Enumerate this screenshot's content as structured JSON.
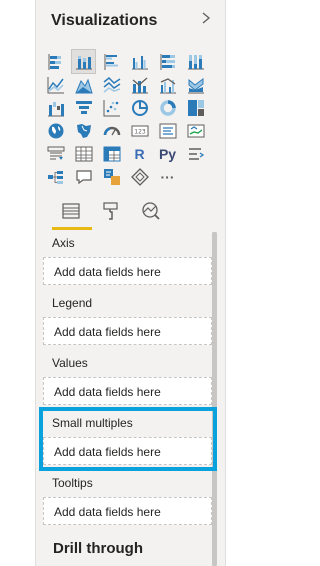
{
  "pane": {
    "title": "Visualizations"
  },
  "visual_types": [
    "stacked-bar-chart-icon",
    "stacked-column-chart-icon",
    "clustered-bar-chart-icon",
    "clustered-column-chart-icon",
    "100-stacked-bar-chart-icon",
    "100-stacked-column-chart-icon",
    "line-chart-icon",
    "area-chart-icon",
    "stacked-area-chart-icon",
    "line-and-stacked-column-icon",
    "line-and-clustered-column-icon",
    "ribbon-chart-icon",
    "waterfall-chart-icon",
    "funnel-chart-icon",
    "scatter-chart-icon",
    "pie-chart-icon",
    "donut-chart-icon",
    "treemap-icon",
    "map-icon",
    "filled-map-icon",
    "gauge-icon",
    "card-icon",
    "multi-row-card-icon",
    "kpi-icon",
    "slicer-icon",
    "table-icon",
    "matrix-icon",
    "r-script-visual-icon",
    "python-visual-icon",
    "key-influencers-icon",
    "decomposition-tree-icon",
    "qa-icon",
    "smart-narrative-icon",
    "power-apps-icon",
    "more-visuals-icon"
  ],
  "tabs": [
    "fields-tab-icon",
    "format-tab-icon",
    "analytics-tab-icon"
  ],
  "wells": [
    {
      "label": "Axis",
      "placeholder": "Add data fields here"
    },
    {
      "label": "Legend",
      "placeholder": "Add data fields here"
    },
    {
      "label": "Values",
      "placeholder": "Add data fields here"
    },
    {
      "label": "Small multiples",
      "placeholder": "Add data fields here"
    },
    {
      "label": "Tooltips",
      "placeholder": "Add data fields here"
    }
  ],
  "drill_through": "Drill through",
  "visual_glyphs": {
    "r": "R",
    "py": "Py",
    "more": "···"
  },
  "accent_color": "#e8b913",
  "highlight_color": "#0aa2dc"
}
